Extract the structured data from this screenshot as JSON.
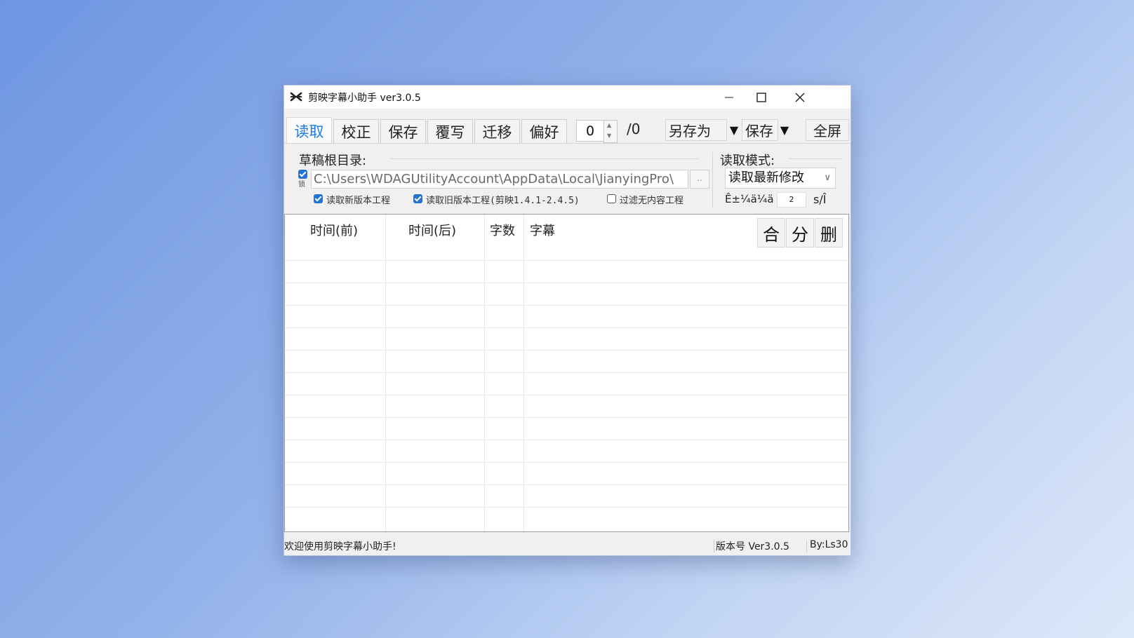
{
  "window": {
    "title": "剪映字幕小助手 ver3.0.5"
  },
  "tabs": [
    {
      "label": "读取",
      "active": true
    },
    {
      "label": "校正"
    },
    {
      "label": "保存"
    },
    {
      "label": "覆写"
    },
    {
      "label": "迁移"
    },
    {
      "label": "偏好"
    }
  ],
  "toolbar": {
    "index_value": "0",
    "total_label": "/0",
    "save_as_label": "另存为",
    "save_label": "保存",
    "dropdown_arrow": "▼",
    "fullscreen_label": "全屏"
  },
  "draft": {
    "group_label": "草稿根目录:",
    "path_value": "C:\\Users\\WDAGUtilityAccount\\AppData\\Local\\JianyingPro\\",
    "lock_char": "锁",
    "browse_label": "..",
    "options": [
      {
        "label": "读取新版本工程",
        "checked": true
      },
      {
        "label": "读取旧版本工程(剪映1.4.1-2.4.5)",
        "checked": true
      },
      {
        "label": "过滤无内容工程",
        "checked": false
      }
    ]
  },
  "read_mode": {
    "group_label": "读取模式:",
    "selected": "读取最新修改",
    "garbled_label": "Ê±¼ä¼ä",
    "seconds_value": "2",
    "unit": "s/Î"
  },
  "table": {
    "columns": [
      "时间(前)",
      "时间(后)",
      "字数",
      "字幕"
    ],
    "rows": [],
    "actions": [
      "合",
      "分",
      "删"
    ]
  },
  "status": {
    "message": "欢迎使用剪映字幕小助手!",
    "version": "版本号 Ver3.0.5",
    "author": "By:Ls30"
  },
  "colors": {
    "accent": "#1f7fe0",
    "checkbox": "#1f74d4"
  }
}
